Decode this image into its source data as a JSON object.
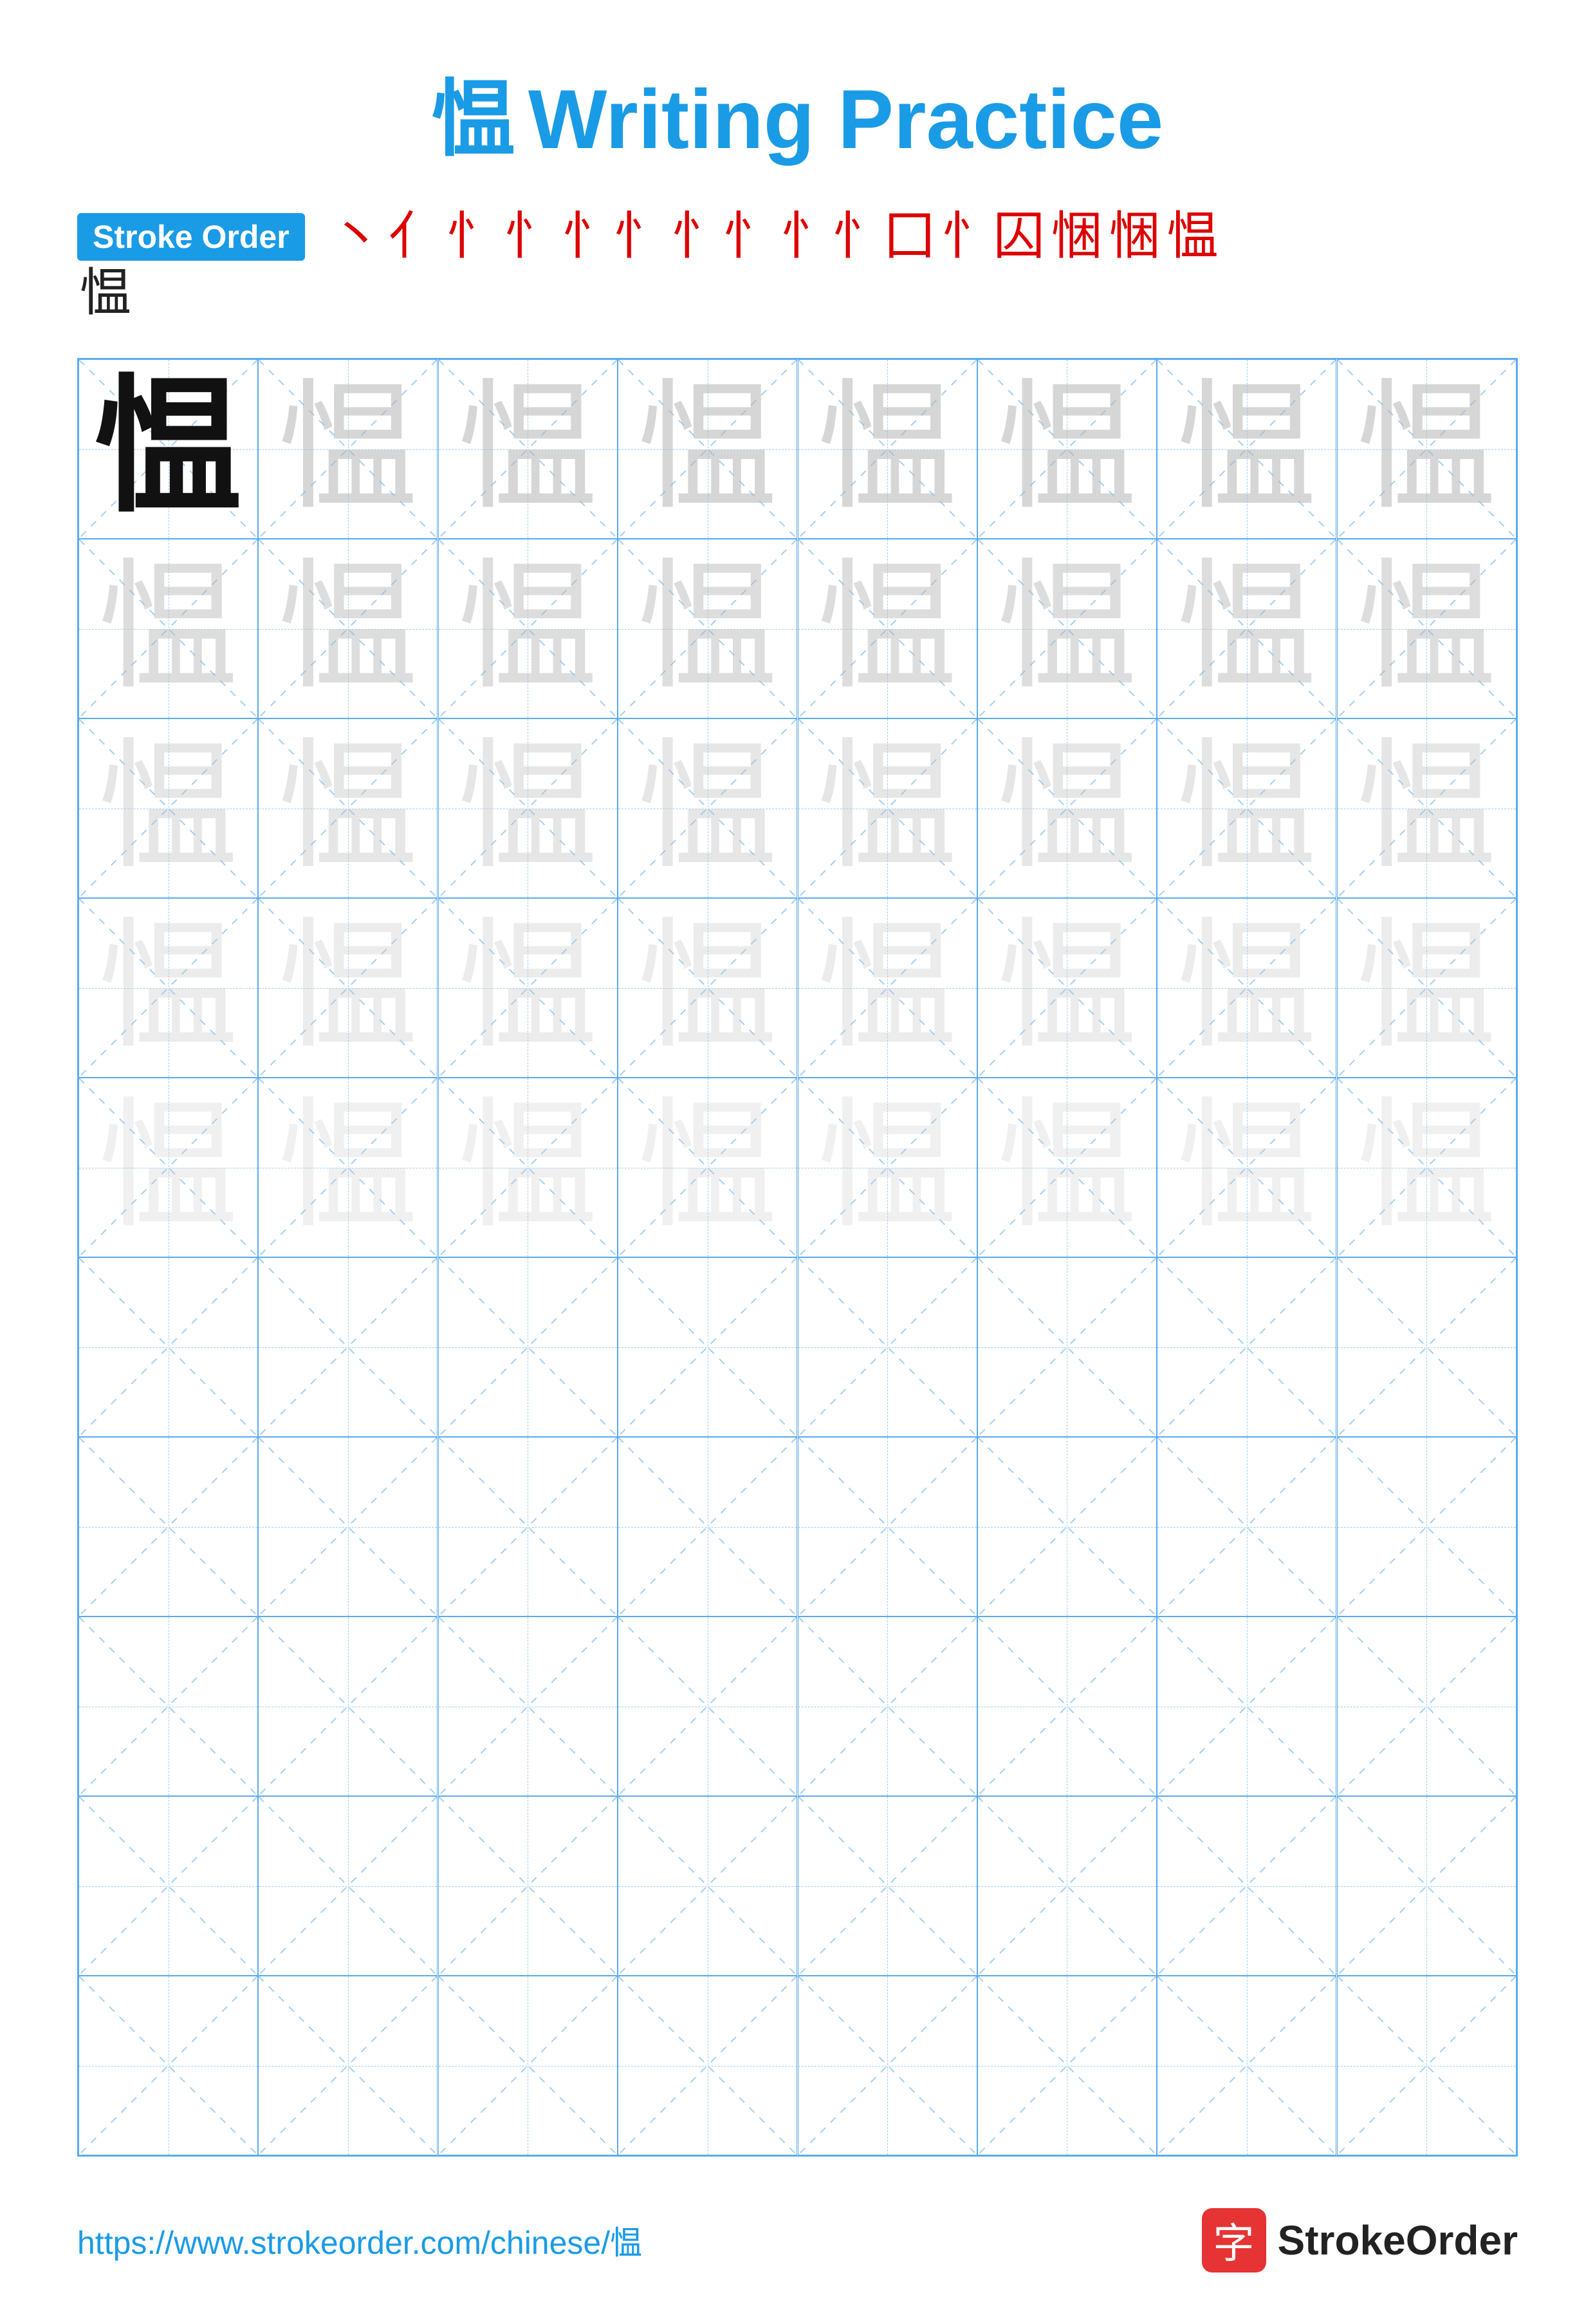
{
  "title": {
    "char": "愠",
    "label": "Writing Practice",
    "full": "愠 Writing Practice"
  },
  "stroke_order": {
    "badge": "Stroke Order",
    "strokes": [
      "丶",
      "亻",
      "忄",
      "忄",
      "忄忄",
      "忄忄",
      "忄忄囗",
      "忄囚",
      "忄囚",
      "悃",
      "愠",
      "愠"
    ]
  },
  "stroke_sequence_display": [
    "丶",
    "亻",
    "忄",
    "忄",
    "忄忄",
    "忄忄",
    "忄忄",
    "忄囗",
    "悃",
    "悃",
    "愠",
    "愠"
  ],
  "target_char": "愠",
  "grid": {
    "cols": 8,
    "rows": 10,
    "guide_rows": 5,
    "empty_rows": 5
  },
  "footer": {
    "url": "https://www.strokeorder.com/chinese/愠",
    "brand_icon": "字",
    "brand_name": "StrokeOrder"
  },
  "colors": {
    "accent": "#1a9be6",
    "red": "#d00000",
    "border": "#5aabf0",
    "guide_dashed": "#a0cef5",
    "brand_red": "#e63333"
  }
}
